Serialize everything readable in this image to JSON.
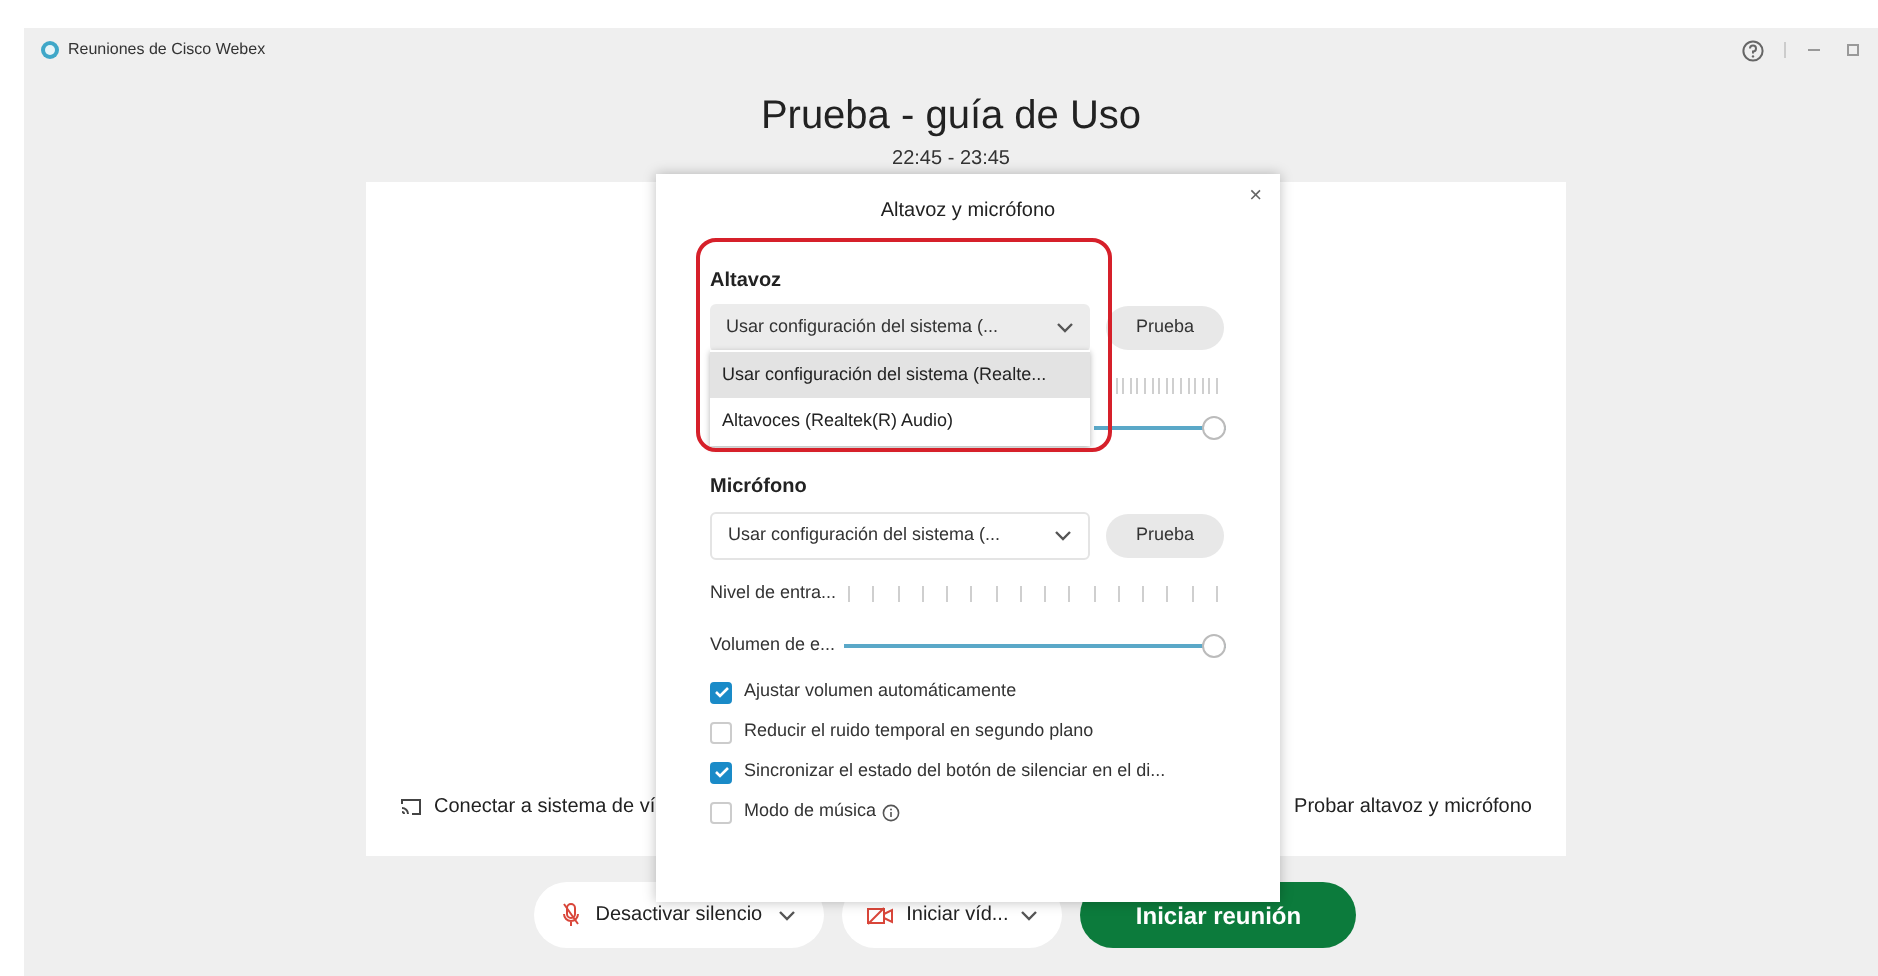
{
  "window": {
    "title": "Reuniones de Cisco Webex"
  },
  "meeting": {
    "title": "Prueba - guía de Uso",
    "time": "22:45 - 23:45",
    "connect_label": "Conectar a sistema de ví",
    "test_link": "Probar altavoz y micrófono"
  },
  "dialog": {
    "title": "Altavoz y micrófono",
    "close": "×",
    "speaker": {
      "label": "Altavoz",
      "device": "Usar configuración del sistema (...",
      "test_button": "Prueba",
      "level": 1,
      "options": [
        {
          "label": "Usar configuración del sistema (Realte...",
          "selected": true
        },
        {
          "label": "Altavoces (Realtek(R) Audio)",
          "selected": false
        }
      ]
    },
    "microphone": {
      "label": "Micrófono",
      "device": "Usar configuración del sistema (...",
      "test_button": "Prueba",
      "input_label": "Nivel de entra...",
      "volume_label": "Volumen de e...",
      "level": 1
    },
    "options": [
      {
        "label": "Ajustar volumen automáticamente",
        "checked": true,
        "info": false
      },
      {
        "label": "Reducir el ruido temporal en segundo plano",
        "checked": false,
        "info": false
      },
      {
        "label": "Sincronizar el estado del botón de silenciar en el di...",
        "checked": true,
        "info": false
      },
      {
        "label": "Modo de música",
        "checked": false,
        "info": true
      }
    ]
  },
  "toolbar": {
    "mute": "Desactivar silencio",
    "video": "Iniciar víd...",
    "start": "Iniciar reunión"
  }
}
